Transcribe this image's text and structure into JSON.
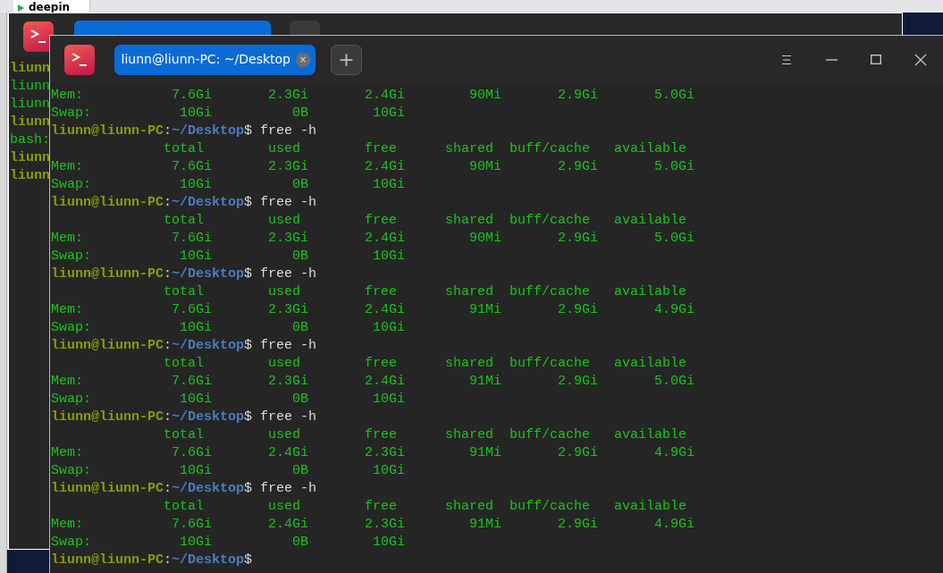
{
  "host_tab": {
    "title": "deepin"
  },
  "back_window": {
    "lines": [
      {
        "kind": "user",
        "text": "liunn"
      },
      {
        "kind": "output",
        "text": "liunn"
      },
      {
        "kind": "output",
        "text": "liunn"
      },
      {
        "kind": "user",
        "text": "liunn"
      },
      {
        "kind": "output",
        "text": "bash:"
      },
      {
        "kind": "user",
        "text": "liunn"
      },
      {
        "kind": "user",
        "text": "liunn"
      }
    ]
  },
  "window": {
    "tabs": [
      {
        "title": "liunn@liunn-PC: ~/Desktop",
        "selected": true,
        "close": "×"
      }
    ],
    "new_tab": "+"
  },
  "terminal": {
    "lines": [
      {
        "kind": "output",
        "text": "Mem:           7.6Gi       2.3Gi       2.4Gi        90Mi       2.9Gi       5.0Gi"
      },
      {
        "kind": "output",
        "text": "Swap:           10Gi          0B        10Gi"
      },
      {
        "kind": "prompt",
        "user": "liunn@liunn-PC",
        "sep": ":",
        "path": "~/Desktop",
        "cmd": "$ free -h"
      },
      {
        "kind": "output",
        "text": "              total        used        free      shared  buff/cache   available"
      },
      {
        "kind": "output",
        "text": "Mem:           7.6Gi       2.3Gi       2.4Gi        90Mi       2.9Gi       5.0Gi"
      },
      {
        "kind": "output",
        "text": "Swap:           10Gi          0B        10Gi"
      },
      {
        "kind": "prompt",
        "user": "liunn@liunn-PC",
        "sep": ":",
        "path": "~/Desktop",
        "cmd": "$ free -h"
      },
      {
        "kind": "output",
        "text": "              total        used        free      shared  buff/cache   available"
      },
      {
        "kind": "output",
        "text": "Mem:           7.6Gi       2.3Gi       2.4Gi        90Mi       2.9Gi       5.0Gi"
      },
      {
        "kind": "output",
        "text": "Swap:           10Gi          0B        10Gi"
      },
      {
        "kind": "prompt",
        "user": "liunn@liunn-PC",
        "sep": ":",
        "path": "~/Desktop",
        "cmd": "$ free -h"
      },
      {
        "kind": "output",
        "text": "              total        used        free      shared  buff/cache   available"
      },
      {
        "kind": "output",
        "text": "Mem:           7.6Gi       2.3Gi       2.4Gi        91Mi       2.9Gi       4.9Gi"
      },
      {
        "kind": "output",
        "text": "Swap:           10Gi          0B        10Gi"
      },
      {
        "kind": "prompt",
        "user": "liunn@liunn-PC",
        "sep": ":",
        "path": "~/Desktop",
        "cmd": "$ free -h"
      },
      {
        "kind": "output",
        "text": "              total        used        free      shared  buff/cache   available"
      },
      {
        "kind": "output",
        "text": "Mem:           7.6Gi       2.3Gi       2.4Gi        91Mi       2.9Gi       5.0Gi"
      },
      {
        "kind": "output",
        "text": "Swap:           10Gi          0B        10Gi"
      },
      {
        "kind": "prompt",
        "user": "liunn@liunn-PC",
        "sep": ":",
        "path": "~/Desktop",
        "cmd": "$ free -h"
      },
      {
        "kind": "output",
        "text": "              total        used        free      shared  buff/cache   available"
      },
      {
        "kind": "output",
        "text": "Mem:           7.6Gi       2.4Gi       2.3Gi        91Mi       2.9Gi       4.9Gi"
      },
      {
        "kind": "output",
        "text": "Swap:           10Gi          0B        10Gi"
      },
      {
        "kind": "prompt",
        "user": "liunn@liunn-PC",
        "sep": ":",
        "path": "~/Desktop",
        "cmd": "$ free -h"
      },
      {
        "kind": "output",
        "text": "              total        used        free      shared  buff/cache   available"
      },
      {
        "kind": "output",
        "text": "Mem:           7.6Gi       2.4Gi       2.3Gi        91Mi       2.9Gi       4.9Gi"
      },
      {
        "kind": "output",
        "text": "Swap:           10Gi          0B        10Gi"
      },
      {
        "kind": "prompt",
        "user": "liunn@liunn-PC",
        "sep": ":",
        "path": "~/Desktop",
        "cmd": "$"
      }
    ]
  }
}
